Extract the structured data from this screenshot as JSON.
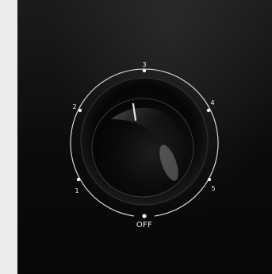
{
  "dial": {
    "label_3": "3",
    "label_2": "2",
    "label_4": "4",
    "label_1": "1",
    "label_5": "5",
    "off_label": "OFF",
    "pointer_position": "3"
  },
  "colors": {
    "panel": "#0b0b0b",
    "ring": "#f2f2f2",
    "knob": "#0a0a0a",
    "background": "#e8e8e8"
  }
}
